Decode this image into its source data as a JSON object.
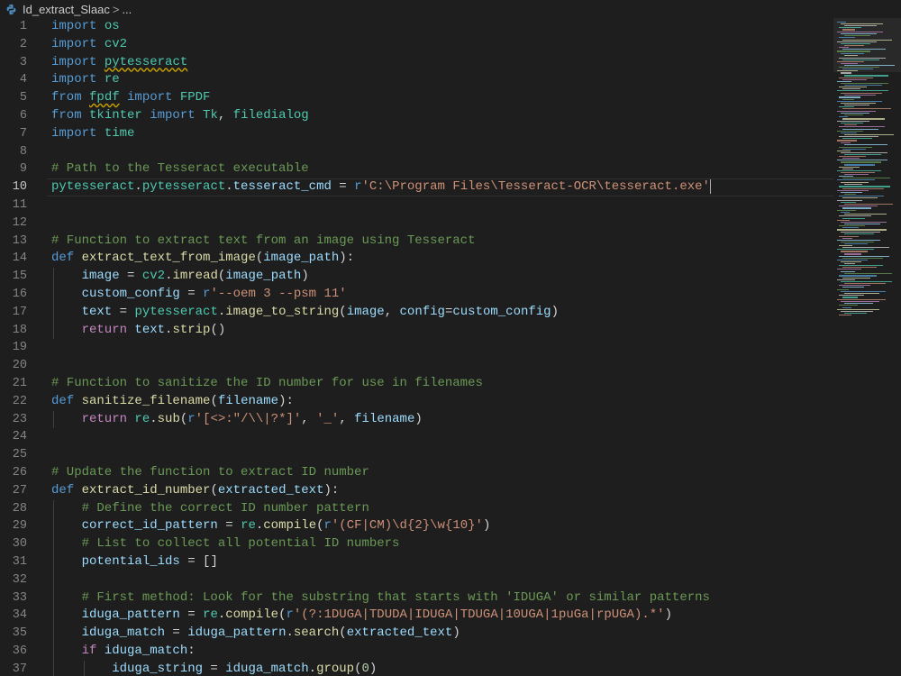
{
  "breadcrumb": {
    "file_icon": "python-file-icon",
    "file_name": "Id_extract_Slaac",
    "separator": ">",
    "ellipsis": "..."
  },
  "editor": {
    "current_line": 10,
    "lines": [
      {
        "n": "1",
        "t": [
          [
            "import",
            "kw"
          ],
          [
            " os",
            "mod"
          ]
        ]
      },
      {
        "n": "2",
        "t": [
          [
            "import",
            "kw"
          ],
          [
            " cv2",
            "mod"
          ]
        ]
      },
      {
        "n": "3",
        "t": [
          [
            "import",
            "kw"
          ],
          [
            " ",
            "pl"
          ],
          [
            "pytesseract",
            "modsq"
          ]
        ]
      },
      {
        "n": "4",
        "t": [
          [
            "import",
            "kw"
          ],
          [
            " re",
            "mod"
          ]
        ]
      },
      {
        "n": "5",
        "t": [
          [
            "from",
            "kw"
          ],
          [
            " ",
            "pl"
          ],
          [
            "fpdf",
            "modsq"
          ],
          [
            " import",
            "kw"
          ],
          [
            " FPDF",
            "cls"
          ]
        ]
      },
      {
        "n": "6",
        "t": [
          [
            "from",
            "kw"
          ],
          [
            " tkinter",
            "mod"
          ],
          [
            " import",
            "kw"
          ],
          [
            " Tk",
            "cls"
          ],
          [
            ", ",
            "pl"
          ],
          [
            "filedialog",
            "mod"
          ]
        ]
      },
      {
        "n": "7",
        "t": [
          [
            "import",
            "kw"
          ],
          [
            " time",
            "mod"
          ]
        ]
      },
      {
        "n": "8",
        "t": []
      },
      {
        "n": "9",
        "t": [
          [
            "# Path to the Tesseract executable",
            "cm"
          ]
        ]
      },
      {
        "n": "10",
        "t": [
          [
            "pytesseract",
            "mod"
          ],
          [
            ".",
            "pl"
          ],
          [
            "pytesseract",
            "mod"
          ],
          [
            ".",
            "pl"
          ],
          [
            "tesseract_cmd",
            "var"
          ],
          [
            " = ",
            "pl"
          ],
          [
            "r",
            "kw"
          ],
          [
            "'C:\\Program Files\\Tesseract-OCR\\tesseract.exe'",
            "str"
          ]
        ]
      },
      {
        "n": "11",
        "t": []
      },
      {
        "n": "12",
        "t": []
      },
      {
        "n": "13",
        "t": [
          [
            "# Function to extract text from an image using Tesseract",
            "cm"
          ]
        ]
      },
      {
        "n": "14",
        "t": [
          [
            "def",
            "kw"
          ],
          [
            " extract_text_from_image",
            "fn"
          ],
          [
            "(",
            "pl"
          ],
          [
            "image_path",
            "var"
          ],
          [
            "):",
            "pl"
          ]
        ]
      },
      {
        "n": "15",
        "t": [
          [
            "    image",
            "var"
          ],
          [
            " = ",
            "pl"
          ],
          [
            "cv2",
            "mod"
          ],
          [
            ".",
            "pl"
          ],
          [
            "imread",
            "fn"
          ],
          [
            "(",
            "pl"
          ],
          [
            "image_path",
            "var"
          ],
          [
            ")",
            "pl"
          ]
        ]
      },
      {
        "n": "16",
        "t": [
          [
            "    custom_config",
            "var"
          ],
          [
            " = ",
            "pl"
          ],
          [
            "r",
            "kw"
          ],
          [
            "'--oem 3 --psm 11'",
            "str"
          ]
        ]
      },
      {
        "n": "17",
        "t": [
          [
            "    text",
            "var"
          ],
          [
            " = ",
            "pl"
          ],
          [
            "pytesseract",
            "mod"
          ],
          [
            ".",
            "pl"
          ],
          [
            "image_to_string",
            "fn"
          ],
          [
            "(",
            "pl"
          ],
          [
            "image",
            "var"
          ],
          [
            ", ",
            "pl"
          ],
          [
            "config",
            "var"
          ],
          [
            "=",
            "pl"
          ],
          [
            "custom_config",
            "var"
          ],
          [
            ")",
            "pl"
          ]
        ]
      },
      {
        "n": "18",
        "t": [
          [
            "    return",
            "kwc"
          ],
          [
            " text",
            "var"
          ],
          [
            ".",
            "pl"
          ],
          [
            "strip",
            "fn"
          ],
          [
            "()",
            "pl"
          ]
        ]
      },
      {
        "n": "19",
        "t": []
      },
      {
        "n": "20",
        "t": []
      },
      {
        "n": "21",
        "t": [
          [
            "# Function to sanitize the ID number for use in filenames",
            "cm"
          ]
        ]
      },
      {
        "n": "22",
        "t": [
          [
            "def",
            "kw"
          ],
          [
            " sanitize_filename",
            "fn"
          ],
          [
            "(",
            "pl"
          ],
          [
            "filename",
            "var"
          ],
          [
            "):",
            "pl"
          ]
        ]
      },
      {
        "n": "23",
        "t": [
          [
            "    return",
            "kwc"
          ],
          [
            " re",
            "mod"
          ],
          [
            ".",
            "pl"
          ],
          [
            "sub",
            "fn"
          ],
          [
            "(",
            "pl"
          ],
          [
            "r",
            "kw"
          ],
          [
            "'[<>:\"/\\\\|?*]'",
            "str"
          ],
          [
            ", ",
            "pl"
          ],
          [
            "'_'",
            "str"
          ],
          [
            ", ",
            "pl"
          ],
          [
            "filename",
            "var"
          ],
          [
            ")",
            "pl"
          ]
        ]
      },
      {
        "n": "24",
        "t": []
      },
      {
        "n": "25",
        "t": []
      },
      {
        "n": "26",
        "t": [
          [
            "# Update the function to extract ID number",
            "cm"
          ]
        ]
      },
      {
        "n": "27",
        "t": [
          [
            "def",
            "kw"
          ],
          [
            " extract_id_number",
            "fn"
          ],
          [
            "(",
            "pl"
          ],
          [
            "extracted_text",
            "var"
          ],
          [
            "):",
            "pl"
          ]
        ]
      },
      {
        "n": "28",
        "t": [
          [
            "    # Define the correct ID number pattern",
            "cm"
          ]
        ]
      },
      {
        "n": "29",
        "t": [
          [
            "    correct_id_pattern",
            "var"
          ],
          [
            " = ",
            "pl"
          ],
          [
            "re",
            "mod"
          ],
          [
            ".",
            "pl"
          ],
          [
            "compile",
            "fn"
          ],
          [
            "(",
            "pl"
          ],
          [
            "r",
            "kw"
          ],
          [
            "'(CF|CM)\\d{2}\\w{10}'",
            "str"
          ],
          [
            ")",
            "pl"
          ]
        ]
      },
      {
        "n": "30",
        "t": [
          [
            "    # List to collect all potential ID numbers",
            "cm"
          ]
        ]
      },
      {
        "n": "31",
        "t": [
          [
            "    potential_ids",
            "var"
          ],
          [
            " = ",
            "pl"
          ],
          [
            "[]",
            "pl"
          ]
        ]
      },
      {
        "n": "32",
        "t": []
      },
      {
        "n": "33",
        "t": [
          [
            "    # First method: Look for the substring that starts with 'IDUGA' or similar patterns",
            "cm"
          ]
        ]
      },
      {
        "n": "34",
        "t": [
          [
            "    iduga_pattern",
            "var"
          ],
          [
            " = ",
            "pl"
          ],
          [
            "re",
            "mod"
          ],
          [
            ".",
            "pl"
          ],
          [
            "compile",
            "fn"
          ],
          [
            "(",
            "pl"
          ],
          [
            "r",
            "kw"
          ],
          [
            "'(?:1DUGA|TDUDA|IDUGA|TDUGA|10UGA|1puGa|rpUGA).*'",
            "str"
          ],
          [
            ")",
            "pl"
          ]
        ]
      },
      {
        "n": "35",
        "t": [
          [
            "    iduga_match",
            "var"
          ],
          [
            " = ",
            "pl"
          ],
          [
            "iduga_pattern",
            "var"
          ],
          [
            ".",
            "pl"
          ],
          [
            "search",
            "fn"
          ],
          [
            "(",
            "pl"
          ],
          [
            "extracted_text",
            "var"
          ],
          [
            ")",
            "pl"
          ]
        ]
      },
      {
        "n": "36",
        "t": [
          [
            "    if",
            "kwc"
          ],
          [
            " iduga_match",
            "var"
          ],
          [
            ":",
            "pl"
          ]
        ]
      },
      {
        "n": "37",
        "t": [
          [
            "        iduga_string",
            "var"
          ],
          [
            " = ",
            "pl"
          ],
          [
            "iduga_match",
            "var"
          ],
          [
            ".",
            "pl"
          ],
          [
            "group",
            "fn"
          ],
          [
            "(",
            "pl"
          ],
          [
            "0",
            "num"
          ],
          [
            ")",
            "pl"
          ]
        ]
      }
    ]
  },
  "colors": {
    "kw": "#569cd6",
    "kwc": "#c586c0",
    "mod": "#4ec9b0",
    "modsq": "#4ec9b0",
    "cls": "#4ec9b0",
    "fn": "#dcdcaa",
    "var": "#9cdcfe",
    "str": "#ce9178",
    "cm": "#6a9955",
    "num": "#b5cea8",
    "pl": "#d4d4d4",
    "background": "#1e1e1e"
  }
}
